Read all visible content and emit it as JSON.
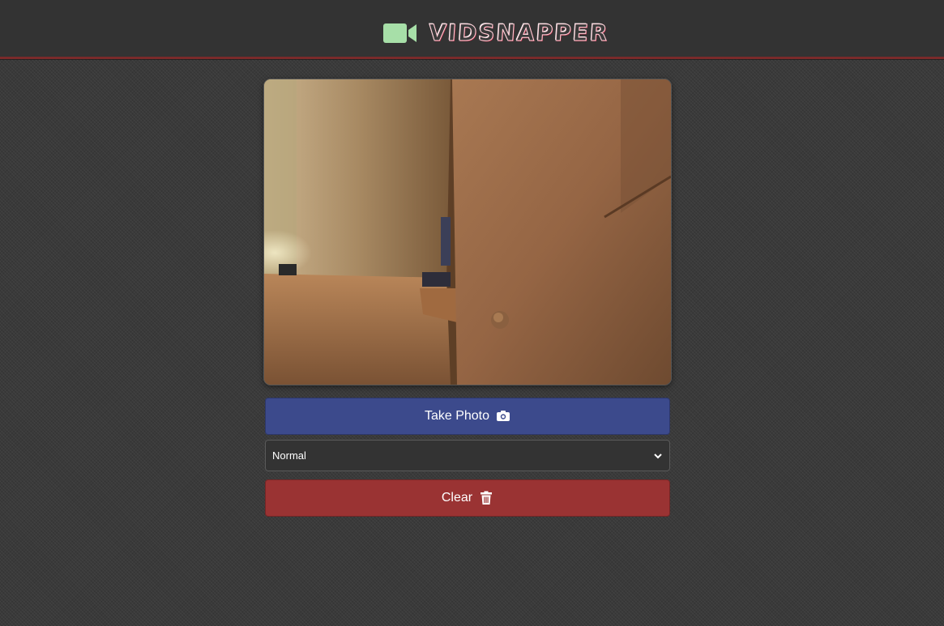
{
  "header": {
    "title": "VIDSNAPPER",
    "icon": "video-camera-icon",
    "accent_color": "#7a2a2a",
    "icon_color": "#a7dfa8"
  },
  "camera": {
    "view": "live-camera-preview"
  },
  "controls": {
    "take_photo_label": "Take Photo",
    "take_photo_icon": "camera-icon",
    "take_photo_color": "#3c4a8c",
    "filter": {
      "selected": "Normal"
    },
    "clear_label": "Clear",
    "clear_icon": "trash-icon",
    "clear_color": "#9a3333"
  }
}
